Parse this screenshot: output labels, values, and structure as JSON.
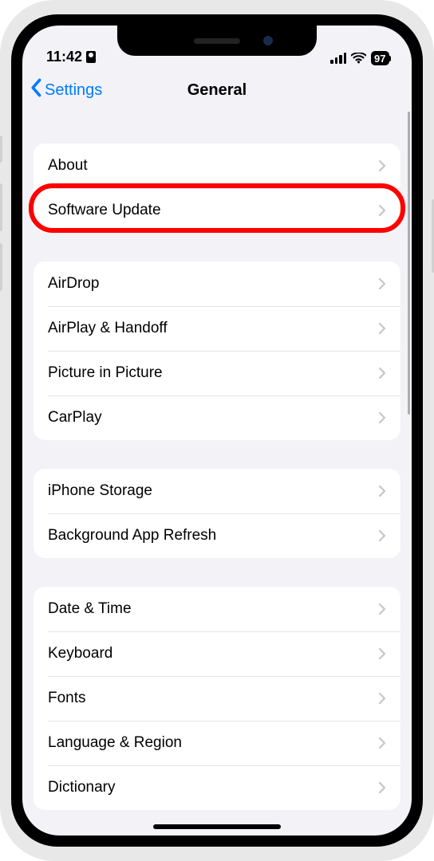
{
  "status": {
    "time": "11:42",
    "battery": "97"
  },
  "nav": {
    "back": "Settings",
    "title": "General"
  },
  "groups": [
    {
      "rows": [
        {
          "label": "About"
        },
        {
          "label": "Software Update",
          "highlighted": true
        }
      ]
    },
    {
      "rows": [
        {
          "label": "AirDrop"
        },
        {
          "label": "AirPlay & Handoff"
        },
        {
          "label": "Picture in Picture"
        },
        {
          "label": "CarPlay"
        }
      ]
    },
    {
      "rows": [
        {
          "label": "iPhone Storage"
        },
        {
          "label": "Background App Refresh"
        }
      ]
    },
    {
      "rows": [
        {
          "label": "Date & Time"
        },
        {
          "label": "Keyboard"
        },
        {
          "label": "Fonts"
        },
        {
          "label": "Language & Region"
        },
        {
          "label": "Dictionary"
        }
      ]
    }
  ],
  "highlight_color": "#ff0000"
}
